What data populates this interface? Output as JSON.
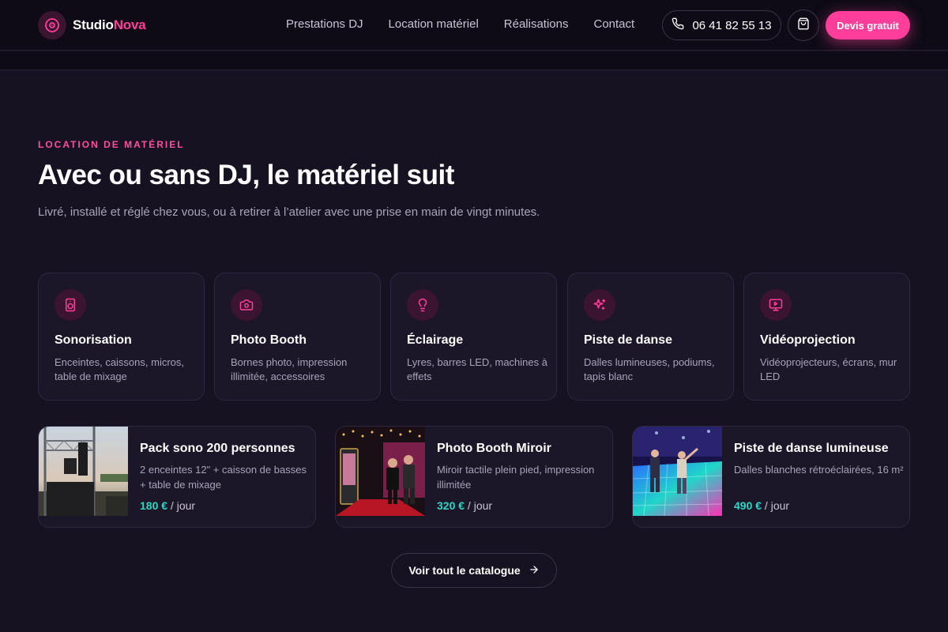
{
  "header": {
    "logo_first": "Studio",
    "logo_second": "Nova",
    "logo_icon": "vinyl-disc-icon",
    "nav": [
      "Prestations DJ",
      "Location matériel",
      "Réalisations",
      "Contact"
    ],
    "phone": "06 41 82 55 13",
    "phone_icon": "phone-icon",
    "cart_icon": "shopping-bag-icon",
    "quote_label": "Devis gratuit"
  },
  "section": {
    "eyebrow": "LOCATION DE MATÉRIEL",
    "title": "Avec ou sans DJ, le matériel suit",
    "lead": "Livré, installé et réglé chez vous, ou à retirer à l’atelier avec une prise en main de vingt minutes."
  },
  "categories": [
    {
      "title": "Sonorisation",
      "desc": "Enceintes, caissons, micros, table de mixage",
      "icon": "speaker-icon"
    },
    {
      "title": "Photo Booth",
      "desc": "Bornes photo, impression illimitée, accessoires",
      "icon": "camera-icon"
    },
    {
      "title": "Éclairage",
      "desc": "Lyres, barres LED, machines à effets",
      "icon": "lightbulb-icon"
    },
    {
      "title": "Piste de danse",
      "desc": "Dalles lumineuses, podiums, tapis blanc",
      "icon": "sparkles-icon"
    },
    {
      "title": "Vidéoprojection",
      "desc": "Vidéoprojecteurs, écrans, mur LED",
      "icon": "screen-play-icon"
    }
  ],
  "products": [
    {
      "title": "Pack sono 200 personnes",
      "desc": "2 enceintes 12\" + caisson de basses + table de mixage",
      "price": "180 €",
      "unit": " / jour"
    },
    {
      "title": "Photo Booth Miroir",
      "desc": "Miroir tactile plein pied, impression illimitée",
      "price": "320 €",
      "unit": " / jour"
    },
    {
      "title": "Piste de danse lumineuse",
      "desc": "Dalles blanches rétroéclairées, 16 m²",
      "price": "490 €",
      "unit": " / jour"
    }
  ],
  "cta": {
    "label": "Voir tout le catalogue",
    "icon": "arrow-right-icon"
  },
  "colors": {
    "background": "#161221",
    "accent": "#ff3e9a",
    "price": "#2fd6c3",
    "card": "#1b1628",
    "icon_bg": "#3b1431"
  }
}
